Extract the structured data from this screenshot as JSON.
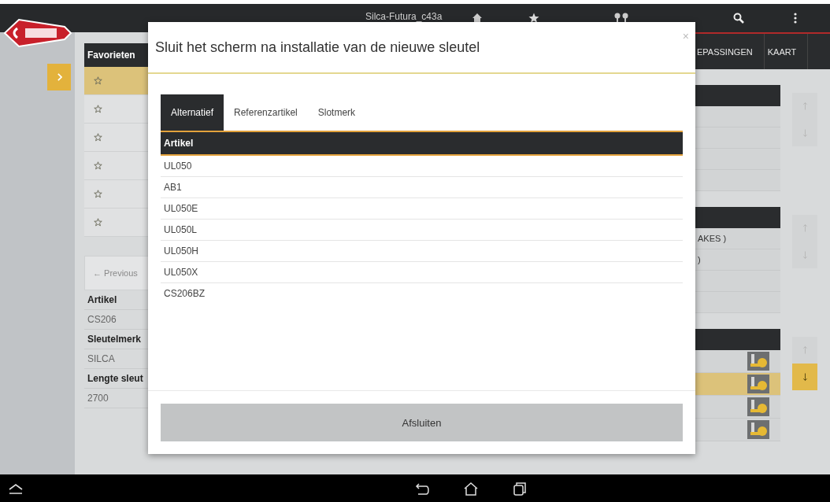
{
  "header": {
    "title": "Silca-Futura_c43a"
  },
  "nav_tabs": [
    {
      "label": "EPASSINGEN"
    },
    {
      "label": "KAART"
    }
  ],
  "favorites": {
    "title": "Favorieten",
    "rows": [
      {
        "selected": true
      },
      {
        "selected": false
      },
      {
        "selected": false
      },
      {
        "selected": false
      },
      {
        "selected": false
      },
      {
        "selected": false
      }
    ]
  },
  "pager": {
    "previous": "← Previous"
  },
  "details": [
    {
      "kind": "label",
      "text": "Artikel"
    },
    {
      "kind": "value",
      "text": "CS206"
    },
    {
      "kind": "label",
      "text": "Sleutelmerk"
    },
    {
      "kind": "value",
      "text": "SILCA"
    },
    {
      "kind": "label",
      "text": "Lengte sleut"
    },
    {
      "kind": "value",
      "text": "2700"
    }
  ],
  "right_panels": [
    {
      "rows": [
        {
          "kind": "blank"
        },
        {
          "kind": "blank"
        },
        {
          "kind": "blank"
        },
        {
          "kind": "blank"
        }
      ],
      "arrows": [
        {
          "kind": "up",
          "selected": false
        },
        {
          "kind": "down",
          "selected": false
        }
      ]
    },
    {
      "rows": [
        {
          "kind": "text",
          "text": "AKES )"
        },
        {
          "kind": "text",
          "text": ")"
        },
        {
          "kind": "blank"
        },
        {
          "kind": "blank"
        }
      ],
      "arrows": [
        {
          "kind": "up",
          "selected": false
        },
        {
          "kind": "down",
          "selected": false
        }
      ]
    },
    {
      "rows": [
        {
          "kind": "key",
          "selected": false
        },
        {
          "kind": "key",
          "selected": true
        },
        {
          "kind": "key",
          "selected": false
        },
        {
          "kind": "key",
          "selected": false
        }
      ],
      "arrows": [
        {
          "kind": "up",
          "selected": false
        },
        {
          "kind": "down",
          "selected": true
        }
      ]
    }
  ],
  "dialog": {
    "title": "Sluit het scherm na installatie van de nieuwe sleutel",
    "close": "×",
    "tabs": [
      {
        "label": "Alternatief",
        "selected": true
      },
      {
        "label": "Referenzartikel",
        "selected": false
      },
      {
        "label": "Slotmerk",
        "selected": false
      }
    ],
    "table": {
      "columns": [
        "Artikel"
      ],
      "rows": [
        "UL050",
        "AB1",
        "UL050E",
        "UL050L",
        "UL050H",
        "UL050X",
        "CS206BZ"
      ]
    },
    "button": "Afsluiten"
  }
}
